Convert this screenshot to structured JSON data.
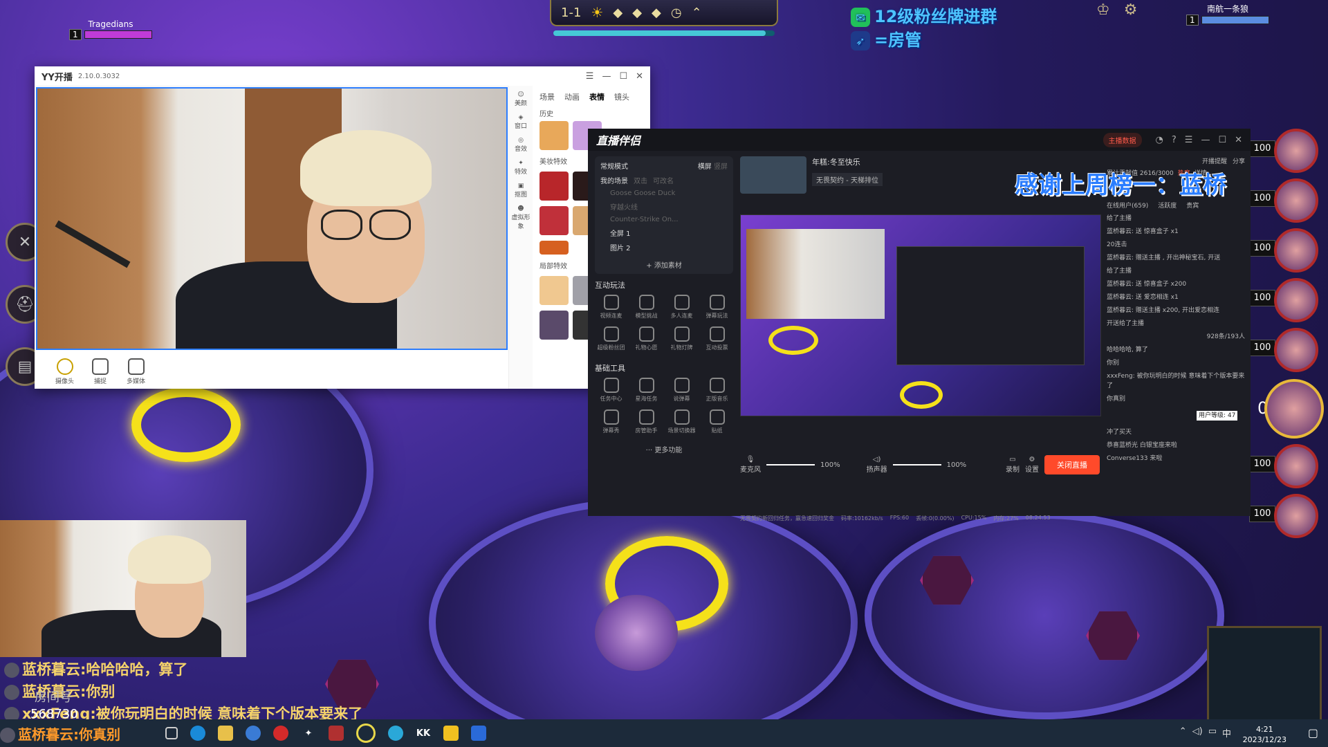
{
  "game": {
    "round": "1-1",
    "left_player": {
      "name": "Tragedians",
      "level": "1"
    },
    "right_player": {
      "name": "南航一条狼",
      "level": "1"
    },
    "promo_line1": "12级粉丝牌进群",
    "promo_line2": "=房管",
    "champion_values": [
      "100",
      "100",
      "100",
      "100",
      "100",
      "100",
      "100"
    ],
    "score_fragment": "00",
    "colors": {
      "ring": "#f5e11a",
      "plate": "#5d4fc4",
      "hex": "#a02b7a"
    }
  },
  "yy_window": {
    "title": "YY开播",
    "version": "2.10.0.3032",
    "side_tools": [
      "美颜",
      "窗口",
      "音效",
      "特效",
      "抠图",
      "虚拟形象"
    ],
    "panel_tabs": [
      "场景",
      "动画",
      "表情",
      "镜头"
    ],
    "active_tab": "表情",
    "sections": [
      "历史",
      "美妆特效",
      "局部特效"
    ],
    "bottom_tools": [
      "摄像头",
      "捕捉",
      "多媒体"
    ]
  },
  "live_companion": {
    "title": "直播伴侣",
    "mode": "常规模式",
    "orientation": [
      "横屏",
      "竖屏"
    ],
    "scene_tabs": [
      "我的场景",
      "双击",
      "可改名"
    ],
    "scenes": [
      "Goose Goose Duck",
      "穿越火线",
      "Counter-Strike On...",
      "全屏 1",
      "图片 2"
    ],
    "add_material": "+ 添加素材",
    "section_interactive": "互动玩法",
    "interactive_items": [
      "视频连麦",
      "模型挑战",
      "多人连麦",
      "弹幕玩法",
      "超级粉丝团",
      "礼物心愿",
      "礼物灯牌",
      "互动投票"
    ],
    "section_tools": "基础工具",
    "tool_items": [
      "任务中心",
      "星海任务",
      "说弹幕",
      "正版音乐",
      "弹幕秀",
      "房管助手",
      "场景切换器",
      "贴纸"
    ],
    "more_features": "··· 更多功能",
    "stream_title": "年糕:冬至快乐",
    "category": "无畏契约 - 天梯排位",
    "mic_label": "麦克风",
    "mic_volume": "100%",
    "speaker_label": "扬声器",
    "speaker_volume": "100%",
    "record_label": "录制",
    "settings_label": "设置",
    "stop_button": "关闭直播",
    "status_bar": [
      "码率:10162kb/s",
      "FPS:60",
      "丢帧:0(0.00%)",
      "CPU:15%",
      "内存:27%",
      "08:24:53"
    ],
    "task_hint": "无畏契约新回归任务，赢急速回归奖金",
    "host_data": "主播数据",
    "contribution": "累计贡献值 2616/3000",
    "hot_label": "热度",
    "details": "详情",
    "right_tabs": [
      "在线用户(659)",
      "活跃度",
      "贵宾"
    ],
    "chat_lines": [
      "给了主播",
      "蓝桥暮云: 送 惊喜盒子 x1",
      "20连击",
      "蓝桥暮云: 赠送主播 , 开出神秘宝石, 开送",
      "给了主播",
      "蓝桥暮云: 送 惊喜盒子 x200",
      "蓝桥暮云: 送 爱恋相连 x1",
      "蓝桥暮云: 赠送主播 x200, 开出爱恋相连",
      "开送给了主播",
      "哈哈哈哈, 算了",
      "你别",
      "xxxFeng: 被你玩明白的时候 意味着下个版本要来了",
      "你真别",
      "冲了买天"
    ],
    "user_level_tip": "用户等级: 47",
    "online_count": "928条/193人",
    "bottom_notice": "恭喜蓝桥光 白银宝座来啦",
    "bottom_welcome": "Converse133 来啦",
    "share": "分享",
    "start_reminder": "开播提醒"
  },
  "thanks_banner": "感谢上周榜一：蓝桥",
  "overlay_chat": [
    {
      "user": "蓝桥暮云",
      "text": "哈哈哈哈，算了",
      "color": "#f5d36a"
    },
    {
      "user": "蓝桥暮云",
      "text": "你别",
      "color": "#f5d36a"
    },
    {
      "user": "xxxFeng",
      "text": "被你玩明白的时候 意味着下个版本要来了",
      "color": "#f5d36a"
    },
    {
      "user": "蓝桥暮云",
      "text": "你真别",
      "color": "#f5d36a"
    }
  ],
  "overlay_id": "568730",
  "overlay_badge": "房间号",
  "taskbar": {
    "time": "4:21",
    "date": "2023/12/23",
    "lang": "中"
  }
}
